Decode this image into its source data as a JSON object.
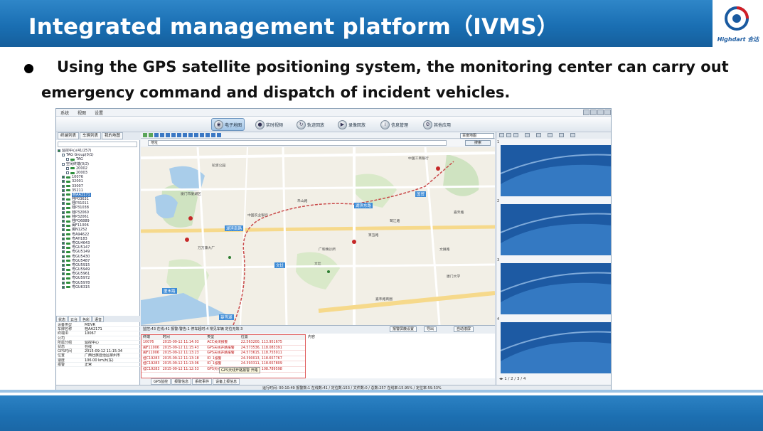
{
  "slide": {
    "title": "Integrated management platform（IVMS）",
    "logo_text": "Highdart 合达",
    "bullet_line1": "Using the GPS satellite positioning system, the monitoring center can carry out",
    "bullet_line2": "emergency command and dispatch of incident vehicles."
  },
  "app": {
    "menu": [
      "系统",
      "视图",
      "设置"
    ],
    "toolbar": [
      {
        "label": "电子地图",
        "icon": "globe-icon",
        "active": true
      },
      {
        "label": "实时视频",
        "icon": "camera-icon"
      },
      {
        "label": "轨迹回放",
        "icon": "track-icon"
      },
      {
        "label": "录像回放",
        "icon": "record-icon"
      },
      {
        "label": "信息管理",
        "icon": "info-icon"
      },
      {
        "label": "其他应用",
        "icon": "apps-icon"
      }
    ],
    "left_tabs": [
      "终端列表",
      "车辆列表",
      "我的地图"
    ],
    "tree": [
      {
        "label": "监控中心(41/257)",
        "indent": 0,
        "checked": true,
        "car": false
      },
      {
        "label": "TAG Group(0/1)",
        "indent": 2,
        "checked": false,
        "car": false
      },
      {
        "label": "TAG",
        "indent": 4,
        "checked": false,
        "car": true
      },
      {
        "label": "空闲终端(0/2)",
        "indent": 2,
        "checked": false,
        "car": false
      },
      {
        "label": "20002",
        "indent": 4,
        "checked": false,
        "car": true
      },
      {
        "label": "20003",
        "indent": 4,
        "checked": false,
        "car": true
      },
      {
        "label": "10076",
        "indent": 2,
        "checked": true,
        "car": true
      },
      {
        "label": "32001",
        "indent": 2,
        "checked": true,
        "car": true
      },
      {
        "label": "33007",
        "indent": 2,
        "checked": true,
        "car": true
      },
      {
        "label": "35211",
        "indent": 2,
        "checked": true,
        "car": true
      },
      {
        "label": "桂AA2171",
        "indent": 2,
        "checked": true,
        "car": true,
        "selected": true
      },
      {
        "label": "桂P03631",
        "indent": 2,
        "checked": true,
        "car": true
      },
      {
        "label": "桂P31011",
        "indent": 2,
        "checked": true,
        "car": true
      },
      {
        "label": "桂P31038",
        "indent": 2,
        "checked": true,
        "car": true
      },
      {
        "label": "桂P32060",
        "indent": 2,
        "checked": true,
        "car": true
      },
      {
        "label": "桂P32061",
        "indent": 2,
        "checked": true,
        "car": true
      },
      {
        "label": "桂PQ6889",
        "indent": 2,
        "checked": true,
        "car": true
      },
      {
        "label": "闽F11006",
        "indent": 2,
        "checked": true,
        "car": true
      },
      {
        "label": "闽N1252",
        "indent": 2,
        "checked": true,
        "car": true
      },
      {
        "label": "粤A94622",
        "indent": 2,
        "checked": true,
        "car": true
      },
      {
        "label": "粤AH183",
        "indent": 2,
        "checked": true,
        "car": true
      },
      {
        "label": "粤GU4643",
        "indent": 2,
        "checked": true,
        "car": true
      },
      {
        "label": "粤GU5147",
        "indent": 2,
        "checked": true,
        "car": true
      },
      {
        "label": "粤GU5149",
        "indent": 2,
        "checked": true,
        "car": true
      },
      {
        "label": "粤GU5430",
        "indent": 2,
        "checked": true,
        "car": true
      },
      {
        "label": "粤GU5487",
        "indent": 2,
        "checked": true,
        "car": true
      },
      {
        "label": "粤GU5915",
        "indent": 2,
        "checked": true,
        "car": true
      },
      {
        "label": "粤GU5949",
        "indent": 2,
        "checked": true,
        "car": true
      },
      {
        "label": "粤GU5961",
        "indent": 2,
        "checked": true,
        "car": true
      },
      {
        "label": "粤GU5972",
        "indent": 2,
        "checked": true,
        "car": true
      },
      {
        "label": "粤GU5978",
        "indent": 2,
        "checked": true,
        "car": true
      },
      {
        "label": "粤GU6315",
        "indent": 2,
        "checked": true,
        "car": true
      }
    ],
    "info_tabs": [
      "状态",
      "云台",
      "色彩",
      "语音"
    ],
    "info": [
      {
        "k": "设备类型",
        "v": "MDVR"
      },
      {
        "k": "车牌名称",
        "v": "桂AA2171"
      },
      {
        "k": "终端ID",
        "v": "10067"
      },
      {
        "k": "公司",
        "v": ""
      },
      {
        "k": "所属分组",
        "v": "监控中心"
      },
      {
        "k": "状态",
        "v": "在线"
      },
      {
        "k": "GPS时间",
        "v": "2015-09-12 11:15:34"
      },
      {
        "k": "位置",
        "v": "广西壮族自治区柳州市"
      },
      {
        "k": "速度",
        "v": "106.00 km/h(东)"
      },
      {
        "k": "报警",
        "v": "正常"
      }
    ],
    "map": {
      "search_placeholder": "地址",
      "search_button": "搜索",
      "map_type": "百度地图",
      "roads": [
        "湖滨南路",
        "湖滨东路",
        "文灶",
        "厦禾路",
        "国贸",
        "箓筜湖"
      ],
      "pois": [
        "中国农业银行",
        "廈门市廈湖区",
        "中国工商银行",
        "万万康大厂",
        "广和精诊所",
        "文灶",
        "轮渡公园",
        "箓筜路",
        "禾山路",
        "鹭江路",
        "文屏路",
        "嘉禾路",
        "廈门大学",
        "嘉禾路商圈"
      ]
    },
    "alarm": {
      "header": "监控:43 在线:41 报警:警告:1 停车超时:4 常见车辆 定位无效:3",
      "button_process": "报警屏蔽设置",
      "button_export": "导出",
      "auto_scroll": "自动滚屏",
      "columns": [
        "终端",
        "时间",
        "类型",
        "位置",
        "内容"
      ],
      "rows": [
        [
          "10076",
          "2015-09-12 11:14:03",
          "ACC关闭报警",
          "22.563200, 113.951675"
        ],
        [
          "闽F11006",
          "2015-09-12 11:15:43",
          "GPS天线开路报警",
          "24.573536, 118.083391"
        ],
        [
          "闽F11006",
          "2015-09-12 11:13:23",
          "GPS天线开路报警",
          "24.573615, 118.755011"
        ],
        [
          "桂C19283",
          "2015-09-12 11:13:18",
          "IO_1报警",
          "24.390013, 118.657767"
        ],
        [
          "桂C19283",
          "2015-09-12 11:13:06",
          "IO_1报警",
          "24.393311, 118.657809"
        ],
        [
          "桂C19283",
          "2015-09-12 11:12:53",
          "GPS天线开路报警",
          "24.971227, 108.789598"
        ]
      ],
      "tooltip": "GPS天线开路报警 开路",
      "tabs": [
        "GPS监控",
        "报警信息",
        "系统事件",
        "设备上报信息"
      ]
    },
    "video": {
      "numbers": [
        "1",
        "2",
        "3",
        "4"
      ],
      "pages": "◂▸ 1 / 2 / 3 / 4"
    },
    "status": "运行时间: 00:10:49  报警数:1  在线数:41 / 定位数:153 / 文件数:0 / 总数:257  在线率:15.95% / 定位率:59.53%"
  }
}
